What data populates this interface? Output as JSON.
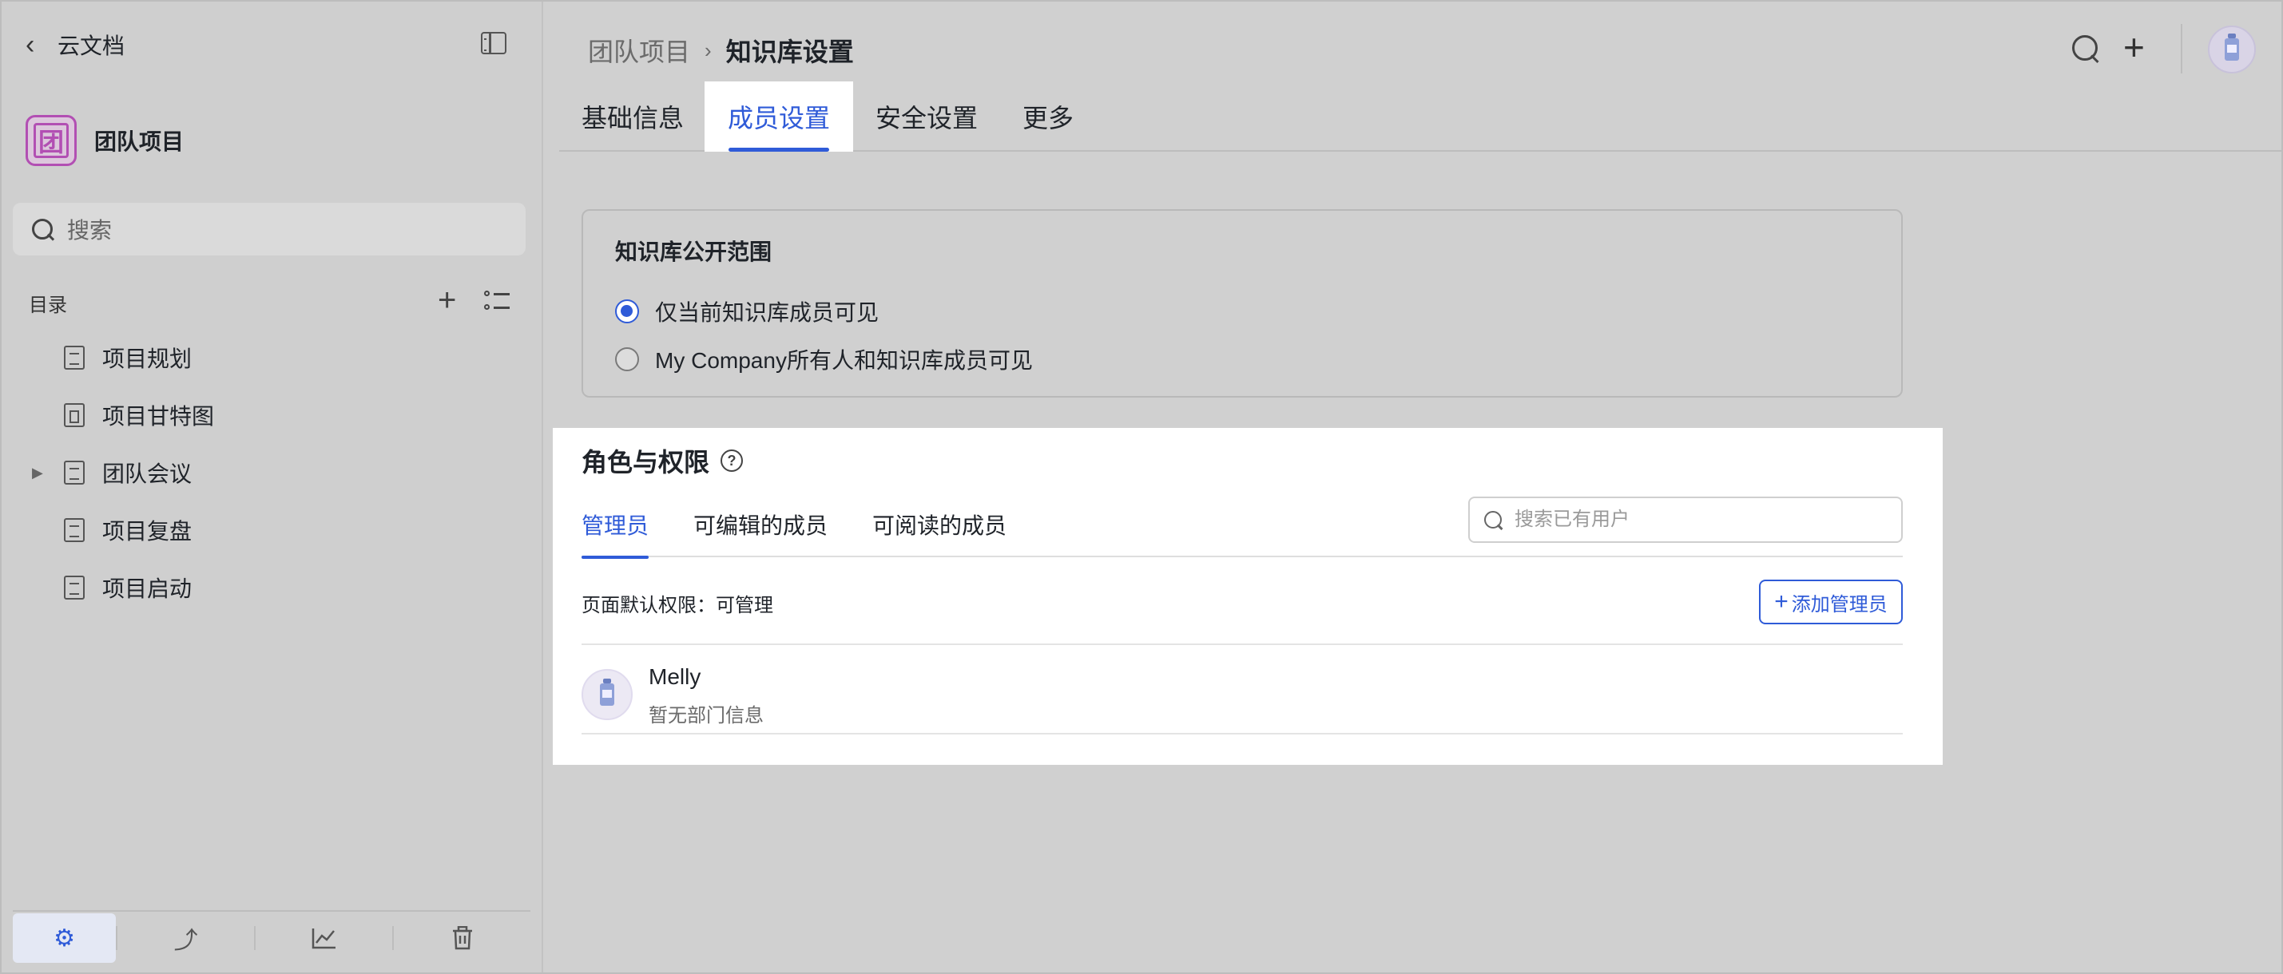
{
  "sidebar": {
    "back_label": "云文档",
    "space": {
      "logo_char": "团",
      "name": "团队项目"
    },
    "search_placeholder": "搜索",
    "toc_heading": "目录",
    "toc_items": [
      {
        "label": "项目规划",
        "icon": "doc-icon"
      },
      {
        "label": "项目甘特图",
        "icon": "sheet-icon"
      },
      {
        "label": "团队会议",
        "icon": "doc-icon",
        "expandable": true
      },
      {
        "label": "项目复盘",
        "icon": "doc-icon"
      },
      {
        "label": "项目启动",
        "icon": "doc-icon"
      }
    ],
    "bottom_icons": [
      "settings-icon",
      "share-icon",
      "analytics-icon",
      "trash-icon"
    ]
  },
  "header": {
    "breadcrumb": {
      "parent": "团队项目",
      "current": "知识库设置"
    }
  },
  "tabs": [
    {
      "label": "基础信息"
    },
    {
      "label": "成员设置",
      "active": true
    },
    {
      "label": "安全设置"
    },
    {
      "label": "更多"
    }
  ],
  "scope": {
    "title": "知识库公开范围",
    "options": [
      {
        "label": "仅当前知识库成员可见",
        "checked": true
      },
      {
        "label": "My Company所有人和知识库成员可见",
        "checked": false
      }
    ]
  },
  "roles": {
    "title": "角色与权限",
    "help_glyph": "?",
    "tabs": [
      {
        "label": "管理员",
        "active": true
      },
      {
        "label": "可编辑的成员"
      },
      {
        "label": "可阅读的成员"
      }
    ],
    "search_placeholder": "搜索已有用户",
    "default_permission": "页面默认权限：可管理",
    "add_button_label": "添加管理员",
    "members": [
      {
        "name": "Melly",
        "department": "暂无部门信息"
      }
    ]
  },
  "colors": {
    "accent": "#2f5bd8",
    "space_logo": "#b24fb3"
  }
}
